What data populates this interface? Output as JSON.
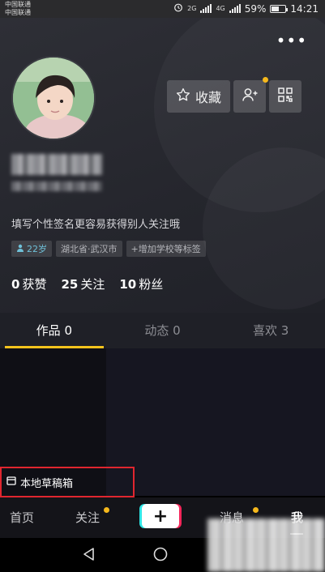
{
  "status_bar": {
    "carrier_1": "中国联通",
    "carrier_2": "中国联通",
    "net_1": "2G",
    "net_2": "4G",
    "battery": "59%",
    "battery_level": 0.59,
    "time": "14:21"
  },
  "profile": {
    "more_label": "•••",
    "favorite_label": "收藏",
    "bio": "填写个性签名更容易获得别人关注哦",
    "tags": {
      "age": "22岁",
      "location": "湖北省·武汉市",
      "add_school": "+增加学校等标签"
    },
    "stats": [
      {
        "num": "0",
        "label": "获赞"
      },
      {
        "num": "25",
        "label": "关注"
      },
      {
        "num": "10",
        "label": "粉丝"
      }
    ]
  },
  "tabs": [
    {
      "label": "作品 0",
      "active": true
    },
    {
      "label": "动态 0",
      "active": false
    },
    {
      "label": "喜欢 3",
      "active": false
    }
  ],
  "draft": {
    "label": "本地草稿箱"
  },
  "bottom_nav": {
    "home": "首页",
    "follow": "关注",
    "plus": "+",
    "messages": "消息",
    "me": "我"
  },
  "colors": {
    "accent_yellow": "#f5c31d",
    "highlight_red": "#e0262f",
    "age_tag": "#6fc1d9"
  }
}
